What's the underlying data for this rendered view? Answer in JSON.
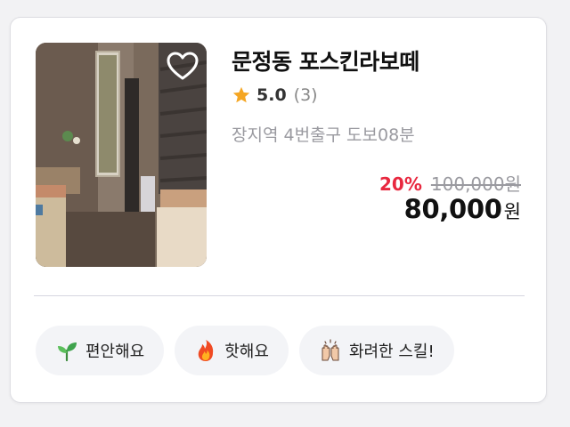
{
  "listing": {
    "title": "문정동 포스킨라보떼",
    "rating": "5.0",
    "review_count": "(3)",
    "location": "장지역 4번출구 도보08분",
    "discount_rate": "20%",
    "original_price": "100,000원",
    "price": "80,000",
    "price_unit": "원"
  },
  "tags": [
    {
      "label": "편안해요",
      "icon": "sprout-icon"
    },
    {
      "label": "핫해요",
      "icon": "flame-icon"
    },
    {
      "label": "화려한 스킬!",
      "icon": "clapping-hands-icon"
    }
  ],
  "colors": {
    "discount": "#e8283f",
    "star": "#f5a623",
    "muted": "#9a9aa0",
    "tag_bg": "#f3f4f7"
  }
}
